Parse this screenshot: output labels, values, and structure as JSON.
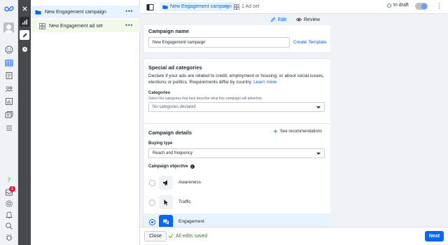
{
  "app": {
    "accent": "#0866ff",
    "success": "#42b72a"
  },
  "rail": {
    "icons": [
      "meta-logo-icon",
      "avatar",
      "smiley-icon",
      "table-icon",
      "pages-icon",
      "people-icon",
      "chart-icon",
      "campaigns-icon",
      "menu-icon",
      "help-icon",
      "notifications-icon",
      "settings-icon",
      "bell-icon",
      "search-icon",
      "bug-icon"
    ],
    "notification_count": "1"
  },
  "tree": {
    "campaign": "New Engagement campaign",
    "adset": "New Engagement ad set",
    "more": "•••"
  },
  "topbar": {
    "breadcrumb_campaign": "New Engagement campaign",
    "breadcrumb_adset": "1 Ad set",
    "status": "In draft",
    "more": "⋮"
  },
  "modes": {
    "edit": "Edit",
    "review": "Review"
  },
  "campaign_name": {
    "heading": "Campaign name",
    "value": "New Engagement campaign",
    "template_link": "Create Template"
  },
  "special_categories": {
    "heading": "Special ad categories",
    "description": "Declare if your ads are related to credit, employment or housing, or about social issues, elections or politics. Requirements differ by country.",
    "learn_more": "Learn more",
    "categories_label": "Categories",
    "categories_help": "Select the categories that best describe what this campaign will advertise.",
    "categories_value": "No categories declared"
  },
  "campaign_details": {
    "heading": "Campaign details",
    "recommendations": "See recommendations",
    "buying_type_label": "Buying type",
    "buying_type_value": "Reach and frequency",
    "objective_label": "Campaign objective",
    "objectives": [
      {
        "name": "Awareness",
        "icon": "megaphone-icon",
        "selected": false
      },
      {
        "name": "Traffic",
        "icon": "cursor-icon",
        "selected": false
      },
      {
        "name": "Engagement",
        "icon": "chat-bubbles-icon",
        "selected": true
      }
    ]
  },
  "footer": {
    "close": "Close",
    "saved": "All edits saved",
    "next": "Next"
  }
}
